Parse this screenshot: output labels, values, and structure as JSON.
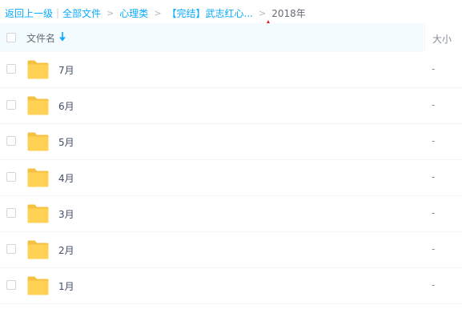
{
  "breadcrumb": {
    "back_label": "返回上一级",
    "all_files_label": "全部文件",
    "separator": ">",
    "path": [
      "心理类",
      "【完结】武志红心..."
    ],
    "current": "2018年"
  },
  "header": {
    "name_label": "文件名",
    "size_label": "大小"
  },
  "rows": [
    {
      "name": "7月",
      "size": "-"
    },
    {
      "name": "6月",
      "size": "-"
    },
    {
      "name": "5月",
      "size": "-"
    },
    {
      "name": "4月",
      "size": "-"
    },
    {
      "name": "3月",
      "size": "-"
    },
    {
      "name": "2月",
      "size": "-"
    },
    {
      "name": "1月",
      "size": "-"
    }
  ],
  "icons": {
    "folder": "folder-icon",
    "sort": "sort-down-arrow-icon",
    "annotation": "red-arrow-up-icon"
  },
  "colors": {
    "link": "#09aaff",
    "folder": "#ffd256",
    "annotation_arrow": "#e02424",
    "header_bg": "#f4fbff"
  }
}
